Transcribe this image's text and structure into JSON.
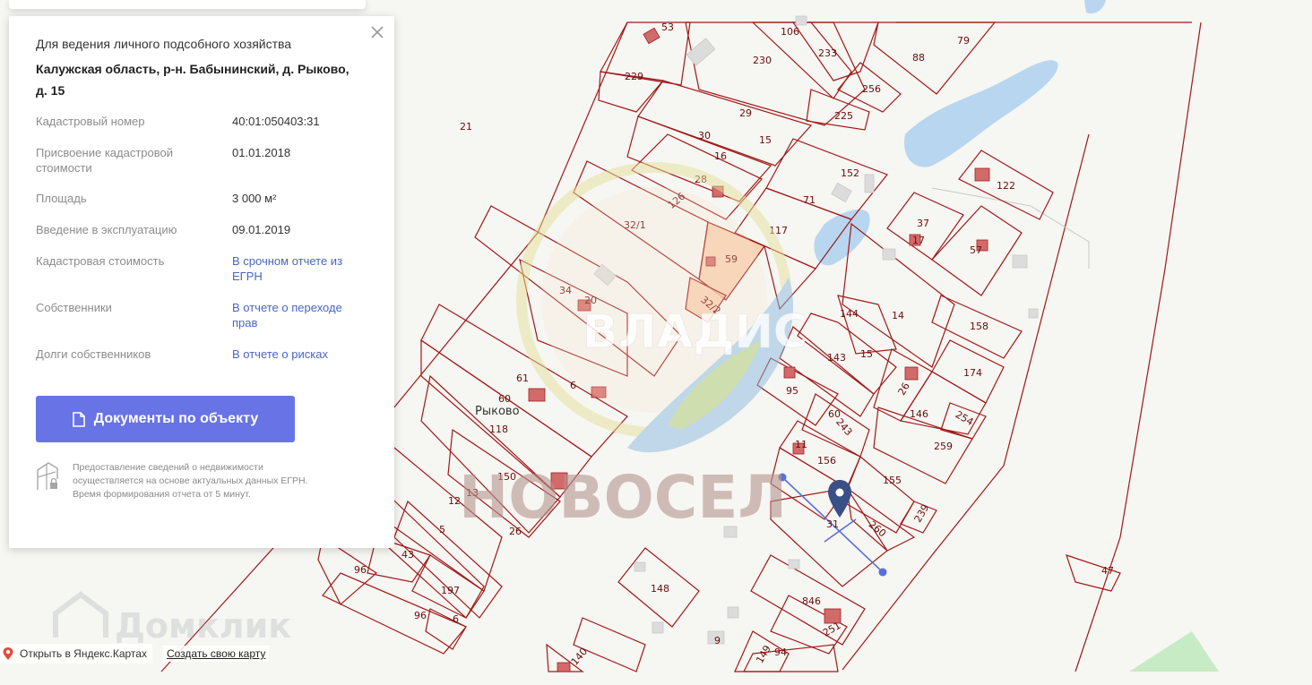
{
  "map": {
    "village_name": "Рыково",
    "watermarks": {
      "vladis": "ВЛАДИС",
      "novosel": "НОВОСЕЛ",
      "domclick": "Домклик"
    },
    "plots": [
      {
        "n": "106"
      },
      {
        "n": "53"
      },
      {
        "n": "233"
      },
      {
        "n": "79"
      },
      {
        "n": "230"
      },
      {
        "n": "229"
      },
      {
        "n": "88"
      },
      {
        "n": "256"
      },
      {
        "n": "21"
      },
      {
        "n": "29"
      },
      {
        "n": "225"
      },
      {
        "n": "30"
      },
      {
        "n": "15"
      },
      {
        "n": "16"
      },
      {
        "n": "152"
      },
      {
        "n": "122"
      },
      {
        "n": "28"
      },
      {
        "n": "126"
      },
      {
        "n": "71"
      },
      {
        "n": "32/1"
      },
      {
        "n": "117"
      },
      {
        "n": "37"
      },
      {
        "n": "17"
      },
      {
        "n": "57"
      },
      {
        "n": "59"
      },
      {
        "n": "34"
      },
      {
        "n": "20"
      },
      {
        "n": "32/2"
      },
      {
        "n": "144"
      },
      {
        "n": "14"
      },
      {
        "n": "158"
      },
      {
        "n": "15"
      },
      {
        "n": "143"
      },
      {
        "n": "61"
      },
      {
        "n": "6"
      },
      {
        "n": "174"
      },
      {
        "n": "95"
      },
      {
        "n": "26"
      },
      {
        "n": "60"
      },
      {
        "n": "146"
      },
      {
        "n": "254"
      },
      {
        "n": "60"
      },
      {
        "n": "243"
      },
      {
        "n": "118"
      },
      {
        "n": "259"
      },
      {
        "n": "11"
      },
      {
        "n": "156"
      },
      {
        "n": "150"
      },
      {
        "n": "155"
      },
      {
        "n": "12"
      },
      {
        "n": "13"
      },
      {
        "n": "239"
      },
      {
        "n": "31"
      },
      {
        "n": "260"
      },
      {
        "n": "5"
      },
      {
        "n": "26"
      },
      {
        "n": "47"
      },
      {
        "n": "43"
      },
      {
        "n": "96"
      },
      {
        "n": "197"
      },
      {
        "n": "148"
      },
      {
        "n": "846"
      },
      {
        "n": "96"
      },
      {
        "n": "6"
      },
      {
        "n": "251"
      },
      {
        "n": "9"
      },
      {
        "n": "140"
      },
      {
        "n": "149"
      },
      {
        "n": "94"
      }
    ]
  },
  "panel": {
    "subtitle": "Для ведения личного подсобного хозяйства",
    "address": "Калужская область, р-н. Бабынинский, д. Рыково, д. 15",
    "rows": [
      {
        "label": "Кадастровый номер",
        "value": "40:01:050403:31",
        "link": false
      },
      {
        "label": "Присвоение кадастровой стоимости",
        "value": "01.01.2018",
        "link": false
      },
      {
        "label": "Площадь",
        "value": "3 000 м²",
        "link": false
      },
      {
        "label": "Введение в эксплуатацию",
        "value": "09.01.2019",
        "link": false
      },
      {
        "label": "Кадастровая стоимость",
        "value": "В срочном отчете из ЕГРН",
        "link": true
      },
      {
        "label": "Собственники",
        "value": "В отчете о переходе прав",
        "link": true
      },
      {
        "label": "Долги собственников",
        "value": "В отчете о рисках",
        "link": true
      }
    ],
    "button_label": "Документы по объекту",
    "note": "Предоставление сведений о недвижимости осуществляется на основе актуальных данных ЕГРН. Время формирования отчета от 5 минут."
  },
  "footer": {
    "open_yandex": "Открыть в Яндекс.Картах",
    "create_map": "Создать свою карту"
  },
  "colors": {
    "plot_stroke": "#a01818",
    "water": "#b8d6f0",
    "button": "#6873e6",
    "link": "#4a64c8",
    "highlight_plot": "#f7c49d"
  }
}
